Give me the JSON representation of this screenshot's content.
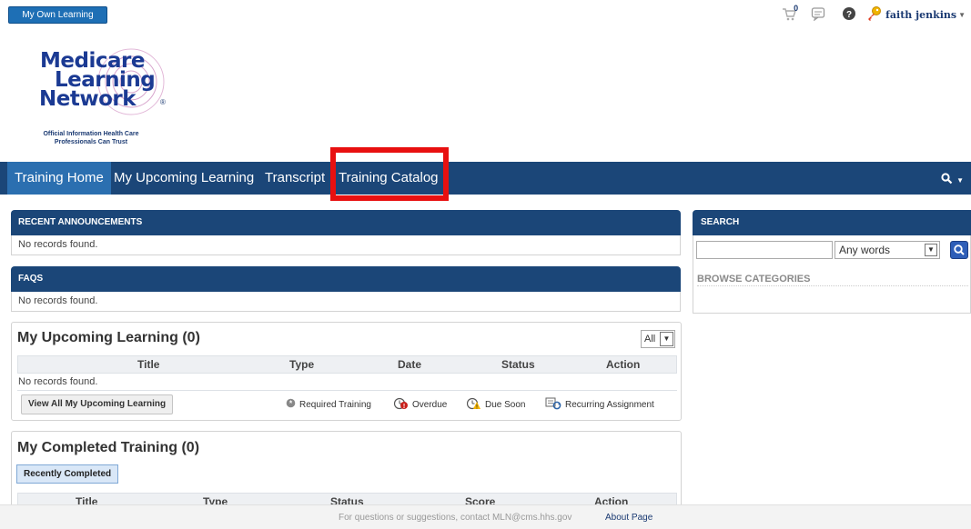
{
  "topbar": {
    "my_own_learning": "My Own Learning",
    "cart_count": "0",
    "user_name": "faith jenkins"
  },
  "logo": {
    "line1": "Medicare",
    "line2": "Learning",
    "line3": "Network",
    "registered": "®",
    "tagline": "Official Information Health Care Professionals Can Trust"
  },
  "nav": {
    "items": [
      "Training Home",
      "My Upcoming Learning",
      "Transcript",
      "Training Catalog"
    ]
  },
  "announcements": {
    "title": "RECENT ANNOUNCEMENTS",
    "empty": "No records found."
  },
  "faqs": {
    "title": "FAQS",
    "empty": "No records found."
  },
  "upcoming": {
    "title": "My Upcoming Learning (0)",
    "filter_value": "All",
    "columns": [
      "Title",
      "Type",
      "Date",
      "Status",
      "Action"
    ],
    "empty": "No records found.",
    "view_all": "View All My Upcoming Learning",
    "legend": [
      "Required Training",
      "Overdue",
      "Due Soon",
      "Recurring Assignment"
    ]
  },
  "completed": {
    "title": "My Completed Training (0)",
    "tab": "Recently Completed",
    "columns": [
      "Title",
      "Type",
      "Status",
      "Score",
      "Action"
    ]
  },
  "search": {
    "title": "SEARCH",
    "query": "",
    "mode": "Any words",
    "browse": "BROWSE CATEGORIES"
  },
  "footer": {
    "message": "For questions or suggestions, contact MLN@cms.hhs.gov",
    "about": "About Page"
  },
  "colors": {
    "nav": "#1b4678",
    "nav_active": "#2b6fb0",
    "highlight": "#e81010",
    "logo_blue": "#1b3a93"
  }
}
